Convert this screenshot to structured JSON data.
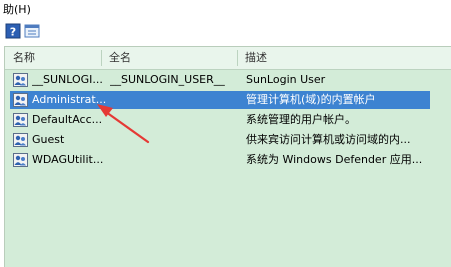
{
  "menubar": {
    "help_label": "助(H)"
  },
  "columns": [
    {
      "label": "名称"
    },
    {
      "label": "全名"
    },
    {
      "label": "描述"
    }
  ],
  "rows": [
    {
      "name": "__SUNLOGI...",
      "fullname": "__SUNLOGIN_USER__",
      "description": "SunLogin User",
      "selected": false
    },
    {
      "name": "Administrat...",
      "fullname": "",
      "description": "管理计算机(域)的内置帐户",
      "selected": true
    },
    {
      "name": "DefaultAcc...",
      "fullname": "",
      "description": "系统管理的用户帐户。",
      "selected": false
    },
    {
      "name": "Guest",
      "fullname": "",
      "description": "供来宾访问计算机或访问域的内...",
      "selected": false
    },
    {
      "name": "WDAGUtilit...",
      "fullname": "",
      "description": "系统为 Windows Defender 应用...",
      "selected": false
    }
  ],
  "colors": {
    "list_background": "#d3ecd8",
    "selection": "#3d83d1",
    "annotation_arrow": "#e53935"
  }
}
